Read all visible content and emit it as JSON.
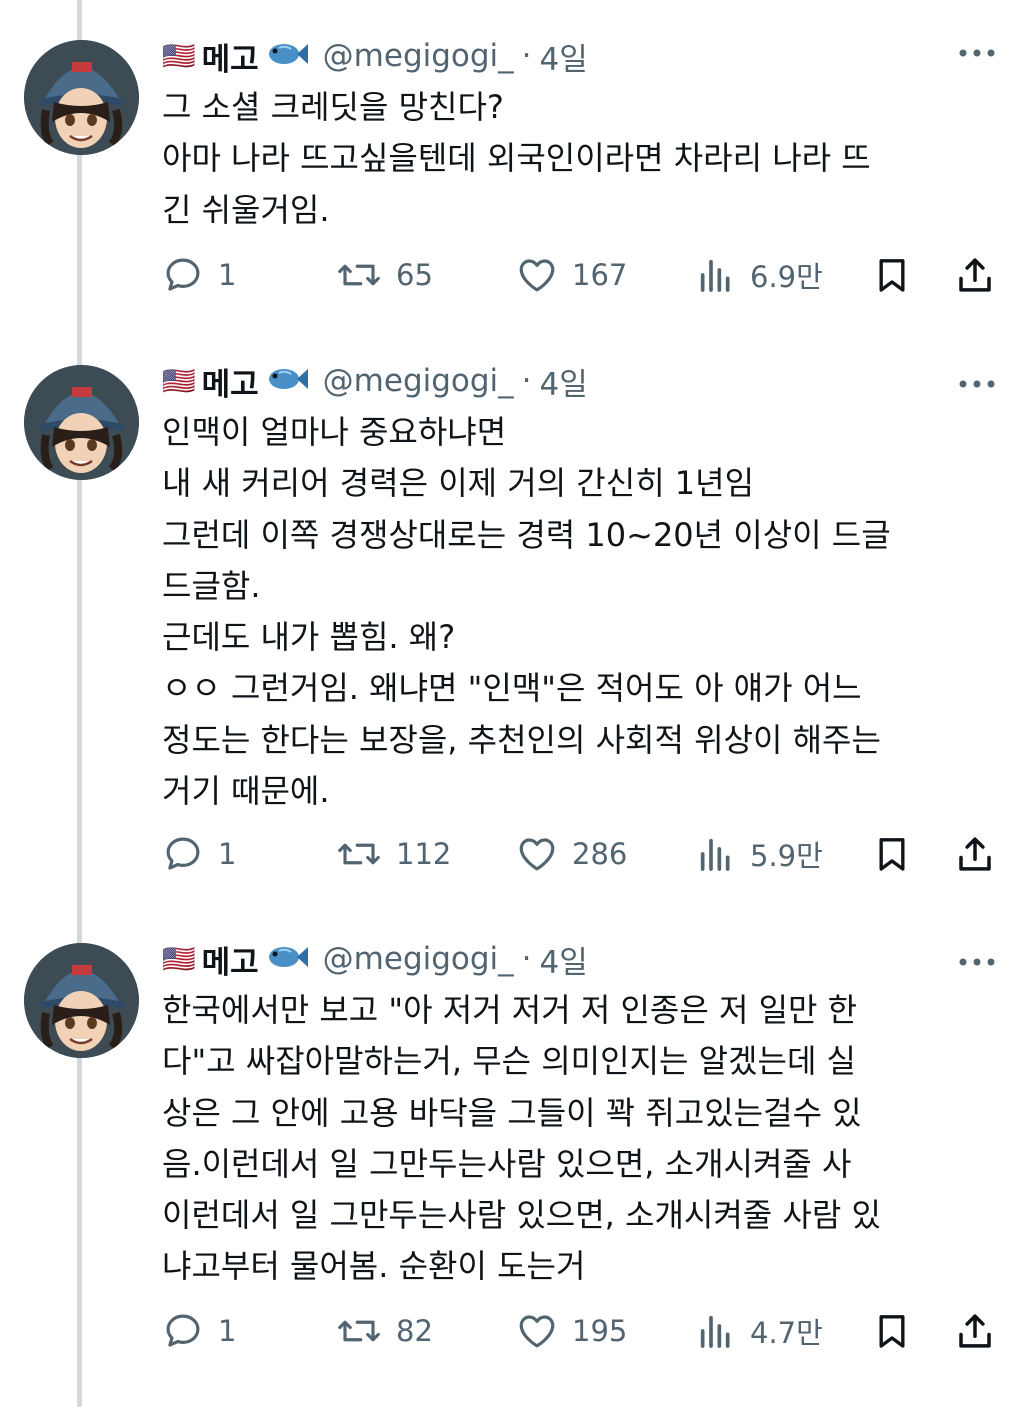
{
  "tweets": [
    {
      "author": {
        "name": "메고",
        "handle": "@megigogi_",
        "flag": "🇺🇸"
      },
      "time": "4일",
      "lines": [
        "그 소셜 크레딧을 망친다?",
        "아마 나라 뜨고싶을텐데 외국인이라면 차라리 나라 뜨",
        "긴 쉬울거임."
      ],
      "stats": {
        "replies": "1",
        "reposts": "65",
        "likes": "167",
        "views": "6.9만"
      }
    },
    {
      "author": {
        "name": "메고",
        "handle": "@megigogi_",
        "flag": "🇺🇸"
      },
      "time": "4일",
      "lines": [
        "인맥이 얼마나 중요하냐면",
        "내 새 커리어 경력은 이제 거의 간신히 1년임",
        "그런데 이쪽 경쟁상대로는 경력 10~20년 이상이 드글",
        "드글함.",
        "근데도 내가 뽑힘. 왜?",
        "ㅇㅇ 그런거임. 왜냐면 \"인맥\"은 적어도 아 얘가 어느",
        "정도는 한다는 보장을, 추천인의 사회적 위상이 해주는",
        "거기 때문에."
      ],
      "stats": {
        "replies": "1",
        "reposts": "112",
        "likes": "286",
        "views": "5.9만"
      }
    },
    {
      "author": {
        "name": "메고",
        "handle": "@megigogi_",
        "flag": "🇺🇸"
      },
      "time": "4일",
      "lines": [
        "한국에서만 보고 \"아 저거 저거 저 인종은 저 일만 한",
        "다\"고 싸잡아말하는거, 무슨 의미인지는 알겠는데 실",
        "상은 그 안에 고용 바닥을 그들이 꽉 쥐고있는걸수 있",
        "음.이런데서 일 그만두는사람 있으면, 소개시켜줄 사",
        "이런데서 일 그만두는사람 있으면, 소개시켜줄 사람 있",
        "냐고부터 물어봄. 순환이 도는거"
      ],
      "stats": {
        "replies": "1",
        "reposts": "82",
        "likes": "195",
        "views": "4.7만"
      }
    }
  ],
  "icons": {
    "reply": "reply-icon",
    "repost": "repost-icon",
    "like": "heart-icon",
    "views": "views-icon",
    "bookmark": "bookmark-icon",
    "share": "share-icon",
    "more": "more-icon",
    "fish": "fish-icon",
    "flag": "us-flag-icon"
  },
  "colors": {
    "text": "#0f1419",
    "secondary": "#536471",
    "thread_line": "#cfd9de"
  }
}
